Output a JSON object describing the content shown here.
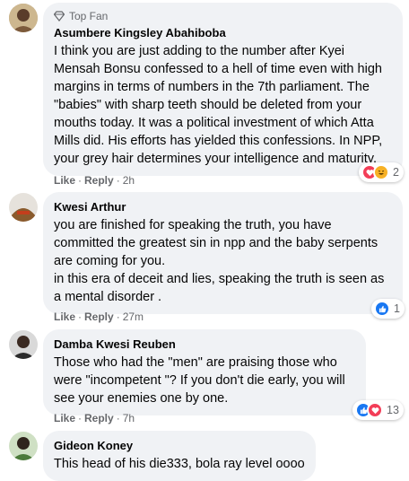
{
  "comments": [
    {
      "badge": "Top Fan",
      "author": "Asumbere Kingsley Abahiboba",
      "text": "I think you are just adding to the number after Kyei Mensah Bonsu confessed to a hell of time even with high margins in terms of numbers in the 7th parliament. The \"babies\" with sharp teeth should be deleted from your mouths today. It was a political investment of which Atta Mills did. His efforts has yielded this confessions. In NPP, your grey hair determines your intelligence and maturity.",
      "like": "Like",
      "reply": "Reply",
      "time": "2h",
      "reaction_count": "2",
      "reactions": [
        "love",
        "haha"
      ]
    },
    {
      "author": "Kwesi Arthur",
      "text": "you are finished for speaking the truth, you have committed the greatest sin in npp and the baby serpents are coming for you.\nin this era of deceit and lies, speaking the truth is seen as a mental disorder .",
      "like": "Like",
      "reply": "Reply",
      "time": "27m",
      "reaction_count": "1",
      "reactions": [
        "like"
      ]
    },
    {
      "author": "Damba Kwesi Reuben",
      "text": "Those who had the \"men\" are praising those who were \"incompetent \"? If you don't die early, you will see your enemies one by one.",
      "like": "Like",
      "reply": "Reply",
      "time": "7h",
      "reaction_count": "13",
      "reactions": [
        "like",
        "love"
      ]
    },
    {
      "author": "Gideon Koney",
      "text": "This head of his die333, bola ray level oooo"
    }
  ],
  "colors": {
    "bubble": "#f0f2f5",
    "like_blue": "#1877f2",
    "love_red": "#f33e58",
    "haha_yellow": "#f7b125",
    "meta_gray": "#65676b"
  }
}
